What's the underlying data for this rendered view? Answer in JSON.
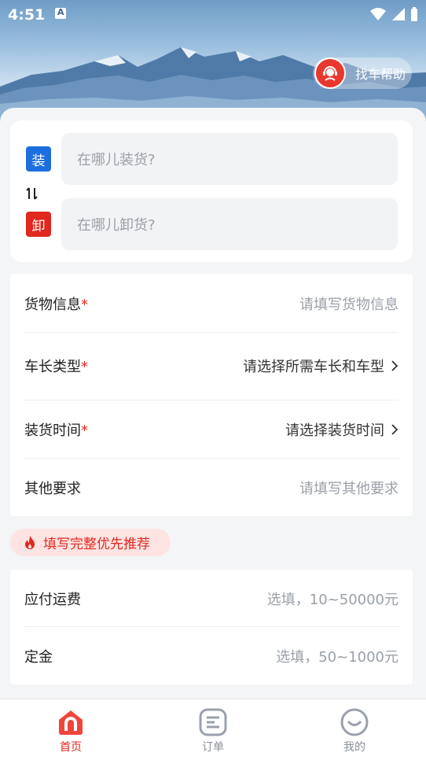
{
  "status_bar": {
    "time": "4:51",
    "notification_icon": "a-letter-icon"
  },
  "header": {
    "help_label": "找车帮助"
  },
  "route": {
    "load_tag": "装",
    "unload_tag": "卸",
    "load_placeholder": "在哪儿装货?",
    "unload_placeholder": "在哪儿卸货?"
  },
  "form": {
    "rows": [
      {
        "label": "货物信息",
        "required": "*",
        "value": "请填写货物信息"
      },
      {
        "label": "车长类型",
        "required": "*",
        "value": "请选择所需车长和车型"
      },
      {
        "label": "装货时间",
        "required": "*",
        "value": "请选择装货时间"
      },
      {
        "label": "其他要求",
        "value": "请填写其他要求"
      }
    ]
  },
  "tip": {
    "text": "填写完整优先推荐"
  },
  "fees": {
    "rows": [
      {
        "label": "应付运费",
        "value": "选填，10~50000元"
      },
      {
        "label": "定金",
        "value": "选填，50~1000元"
      }
    ]
  },
  "tabbar": {
    "tabs": [
      {
        "label": "首页",
        "icon": "home-icon",
        "active": true
      },
      {
        "label": "订单",
        "icon": "order-icon",
        "active": false
      },
      {
        "label": "我的",
        "icon": "smile-icon",
        "active": false
      }
    ]
  },
  "colors": {
    "accent": "#e0281e",
    "load_blue": "#1d6fe0",
    "placeholder": "#9aa0a8"
  }
}
